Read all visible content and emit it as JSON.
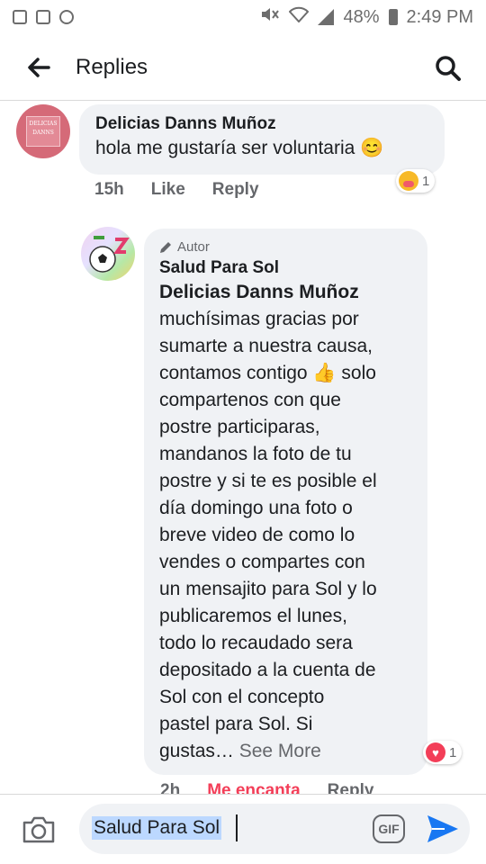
{
  "status_bar": {
    "battery": "48%",
    "time": "2:49 PM"
  },
  "header": {
    "title": "Replies"
  },
  "comment": {
    "author": "Delicias Danns Muñoz",
    "avatar_text": "DELICIAS DANNS",
    "text": "hola me gustaría ser voluntaria 😊",
    "time": "15h",
    "like_label": "Like",
    "reply_label": "Reply",
    "reaction_count": "1"
  },
  "reply": {
    "badge": "Autor",
    "author": "Salud Para Sol",
    "mention": "Delicias Danns Muñoz",
    "lines": [
      "muchísimas gracias por",
      "sumarte a nuestra causa,",
      "contamos contigo 👍 solo",
      "compartenos con que",
      "postre participaras,",
      "mandanos la foto de tu",
      "postre y si te es posible el",
      "día domingo una foto o",
      "breve video de como lo",
      "vendes o compartes con",
      "un mensajito para Sol y lo",
      "publicaremos el lunes,",
      "todo lo recaudado sera",
      "depositado a la cuenta de",
      "Sol con el concepto",
      "pastel para Sol. Si"
    ],
    "last_line": "gustas…",
    "see_more": "See More",
    "time": "2h",
    "love_label": "Me encanta",
    "reply_label": "Reply",
    "reaction_count": "1"
  },
  "composer": {
    "value": "Salud Para Sol",
    "gif_label": "GIF"
  },
  "colors": {
    "bubble": "#f0f2f5",
    "love": "#f33e58",
    "send": "#1877f2"
  }
}
